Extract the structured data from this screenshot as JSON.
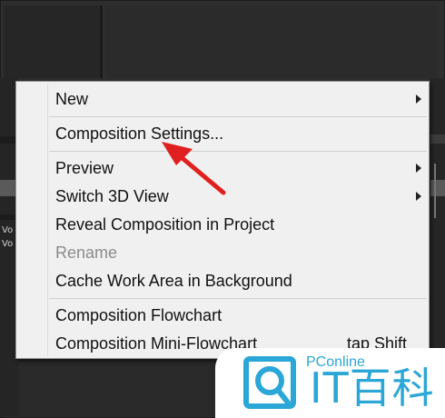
{
  "background": {
    "left_labels": [
      "Vo",
      "Vo"
    ]
  },
  "menu": {
    "items": [
      {
        "label": "New",
        "submenu": true,
        "enabled": true
      },
      {
        "label": "Composition Settings...",
        "submenu": false,
        "enabled": true
      },
      {
        "label": "Preview",
        "submenu": true,
        "enabled": true
      },
      {
        "label": "Switch 3D View",
        "submenu": true,
        "enabled": true
      },
      {
        "label": "Reveal Composition in Project",
        "submenu": false,
        "enabled": true
      },
      {
        "label": "Rename",
        "submenu": false,
        "enabled": false
      },
      {
        "label": "Cache Work Area in Background",
        "submenu": false,
        "enabled": true
      },
      {
        "label": "Composition Flowchart",
        "submenu": false,
        "enabled": true
      },
      {
        "label": "Composition Mini-Flowchart",
        "shortcut": "tap Shift",
        "submenu": false,
        "enabled": true
      }
    ]
  },
  "annotation": {
    "arrow_color": "#e02020",
    "points_to": "Composition Settings..."
  },
  "watermark": {
    "site": "PConline",
    "brand": "IT百科",
    "color": "#2aa7d6",
    "icon": "magnifier-logo-icon"
  }
}
